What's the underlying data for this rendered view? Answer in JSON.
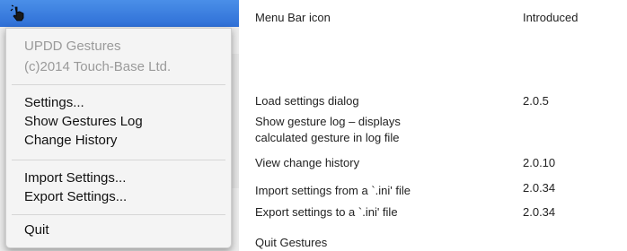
{
  "menu": {
    "header_line1": "UPDD Gestures",
    "header_line2": "(c)2014 Touch-Base Ltd.",
    "items": [
      {
        "label": "Settings..."
      },
      {
        "label": "Show Gestures Log"
      },
      {
        "label": "Change History"
      },
      {
        "label": "Import Settings..."
      },
      {
        "label": "Export Settings..."
      },
      {
        "label": "Quit"
      }
    ]
  },
  "table": {
    "col1_header": "Menu Bar icon",
    "col2_header": "Introduced",
    "rows": [
      {
        "description": "Load settings dialog",
        "version": "2.0.5"
      },
      {
        "description_line1": "Show gesture log – displays",
        "description_line2": "calculated gesture in log file",
        "version": ""
      },
      {
        "description": "View change history",
        "version": "2.0.10"
      },
      {
        "description": "Import settings from a `.ini' file",
        "version": "2.0.34"
      },
      {
        "description": "Export settings to a `.ini' file",
        "version": "2.0.34"
      },
      {
        "description": "Quit Gestures",
        "version": ""
      }
    ]
  },
  "colors": {
    "menubar": "#3c7fe0",
    "menu_background": "#f4f4f4",
    "disabled_text": "#9a9a9a"
  }
}
